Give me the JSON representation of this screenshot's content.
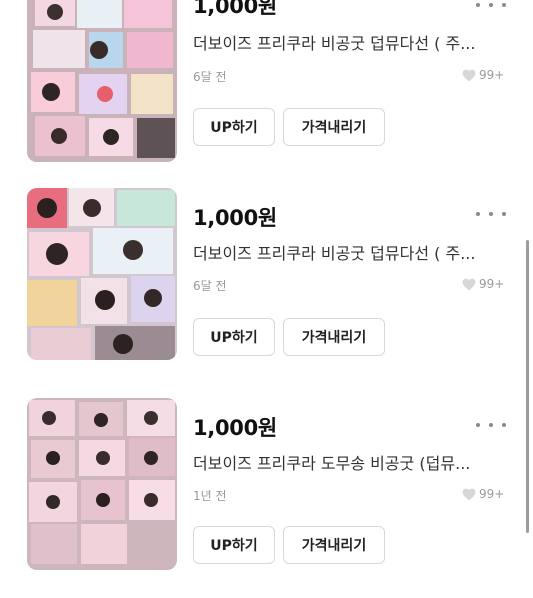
{
  "listings": [
    {
      "price": "1,000원",
      "title": "더보이즈 프리쿠라 비공굿 덥뮤다선 ( 주...",
      "time": "6달 전",
      "likes": "99+",
      "up_label": "UP하기",
      "price_down_label": "가격내리기"
    },
    {
      "price": "1,000원",
      "title": "더보이즈 프리쿠라 비공굿 덥뮤다선 ( 주...",
      "time": "6달 전",
      "likes": "99+",
      "up_label": "UP하기",
      "price_down_label": "가격내리기"
    },
    {
      "price": "1,000원",
      "title": "더보이즈 프리쿠라 도무송 비공굿 (덥뮤...",
      "time": "1년 전",
      "likes": "99+",
      "up_label": "UP하기",
      "price_down_label": "가격내리기"
    }
  ],
  "icons": {
    "like": "heart-icon",
    "more": "more-horizontal-icon"
  }
}
